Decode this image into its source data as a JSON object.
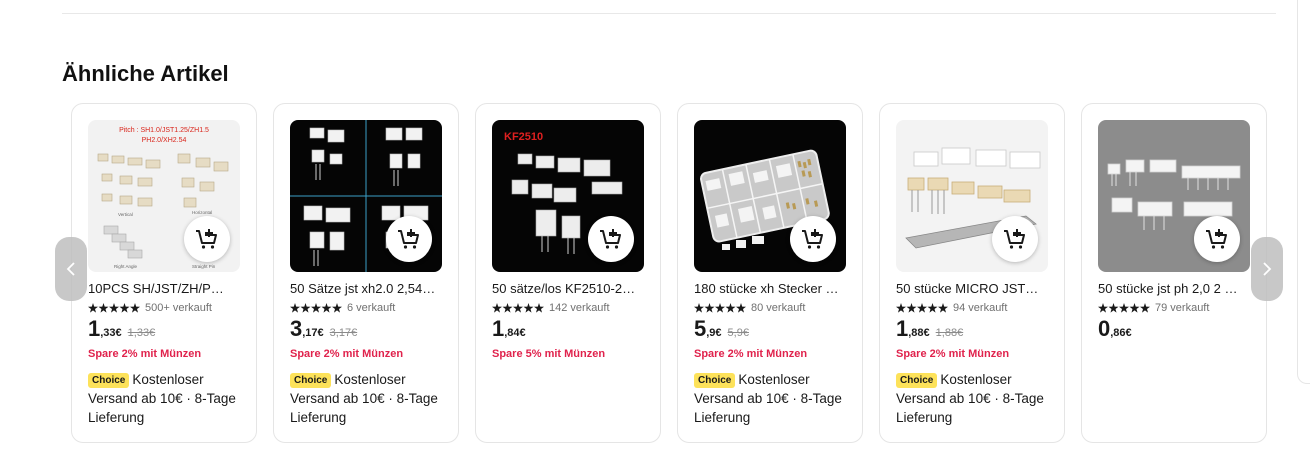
{
  "section": {
    "title": "Ähnliche Artikel"
  },
  "nav": {
    "prev_icon": "chevron-left-icon",
    "next_icon": "chevron-right-icon"
  },
  "colors": {
    "promo": "#e0224c",
    "choice_badge": "#fde25a",
    "star": "#191919"
  },
  "products": [
    {
      "title": "10PCS SH/JST/ZH/P…",
      "rating": 5,
      "sold": "500+ verkauft",
      "price_main": "1",
      "price_dec": ",33€",
      "price_old": "1,33€",
      "promo": "Spare 2% mit Münzen",
      "choice": "Choice",
      "shipping": "Kostenloser Versand ab 10€ · 8-Tage Lieferung",
      "image_text": [
        "Pitch : SH1.0/JST1.25/ZH1.5",
        "PH2.0/XH2.54",
        "Vertical",
        "Horizontal",
        "Right Angle",
        "Straight Pin"
      ]
    },
    {
      "title": "50 Sätze jst xh2.0 2,54…",
      "rating": 5,
      "sold": "6 verkauft",
      "price_main": "3",
      "price_dec": ",17€",
      "price_old": "3,17€",
      "promo": "Spare 2% mit Münzen",
      "choice": "Choice",
      "shipping": "Kostenloser Versand ab 10€ · 8-Tage Lieferung",
      "image_text": []
    },
    {
      "title": "50 sätze/los KF2510-2…",
      "rating": 5,
      "sold": "142 verkauft",
      "price_main": "1",
      "price_dec": ",84€",
      "price_old": "",
      "promo": "Spare 5% mit Münzen",
      "choice": "",
      "shipping": "",
      "image_text": [
        "KF2510"
      ]
    },
    {
      "title": "180 stücke xh Stecker …",
      "rating": 5,
      "sold": "80 verkauft",
      "price_main": "5",
      "price_dec": ",9€",
      "price_old": "5,9€",
      "promo": "Spare 2% mit Münzen",
      "choice": "Choice",
      "shipping": "Kostenloser Versand ab 10€ · 8-Tage Lieferung",
      "image_text": []
    },
    {
      "title": "50 stücke MICRO JST…",
      "rating": 5,
      "sold": "94 verkauft",
      "price_main": "1",
      "price_dec": ",88€",
      "price_old": "1,88€",
      "promo": "Spare 2% mit Münzen",
      "choice": "Choice",
      "shipping": "Kostenloser Versand ab 10€ · 8-Tage Lieferung",
      "image_text": []
    },
    {
      "title": "50 stücke jst ph 2,0 2 …",
      "rating": 5,
      "sold": "79 verkauft",
      "price_main": "0",
      "price_dec": ",86€",
      "price_old": "",
      "promo": "",
      "choice": "",
      "shipping": "",
      "image_text": []
    }
  ]
}
